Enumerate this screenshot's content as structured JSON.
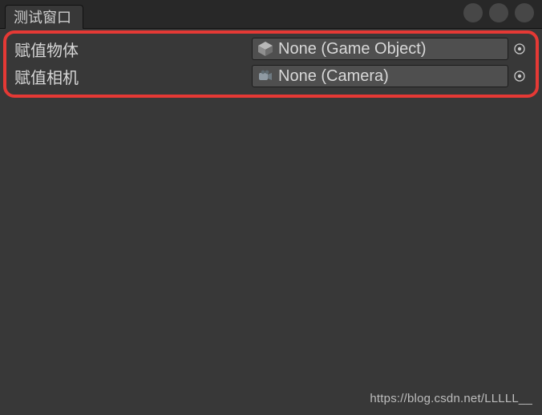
{
  "header": {
    "tab_title": "测试窗口"
  },
  "fields": [
    {
      "label": "赋值物体",
      "value": "None (Game Object)",
      "icon": "cube"
    },
    {
      "label": "赋值相机",
      "value": "None (Camera)",
      "icon": "camera"
    }
  ],
  "watermark": "https://blog.csdn.net/LLLLL__"
}
